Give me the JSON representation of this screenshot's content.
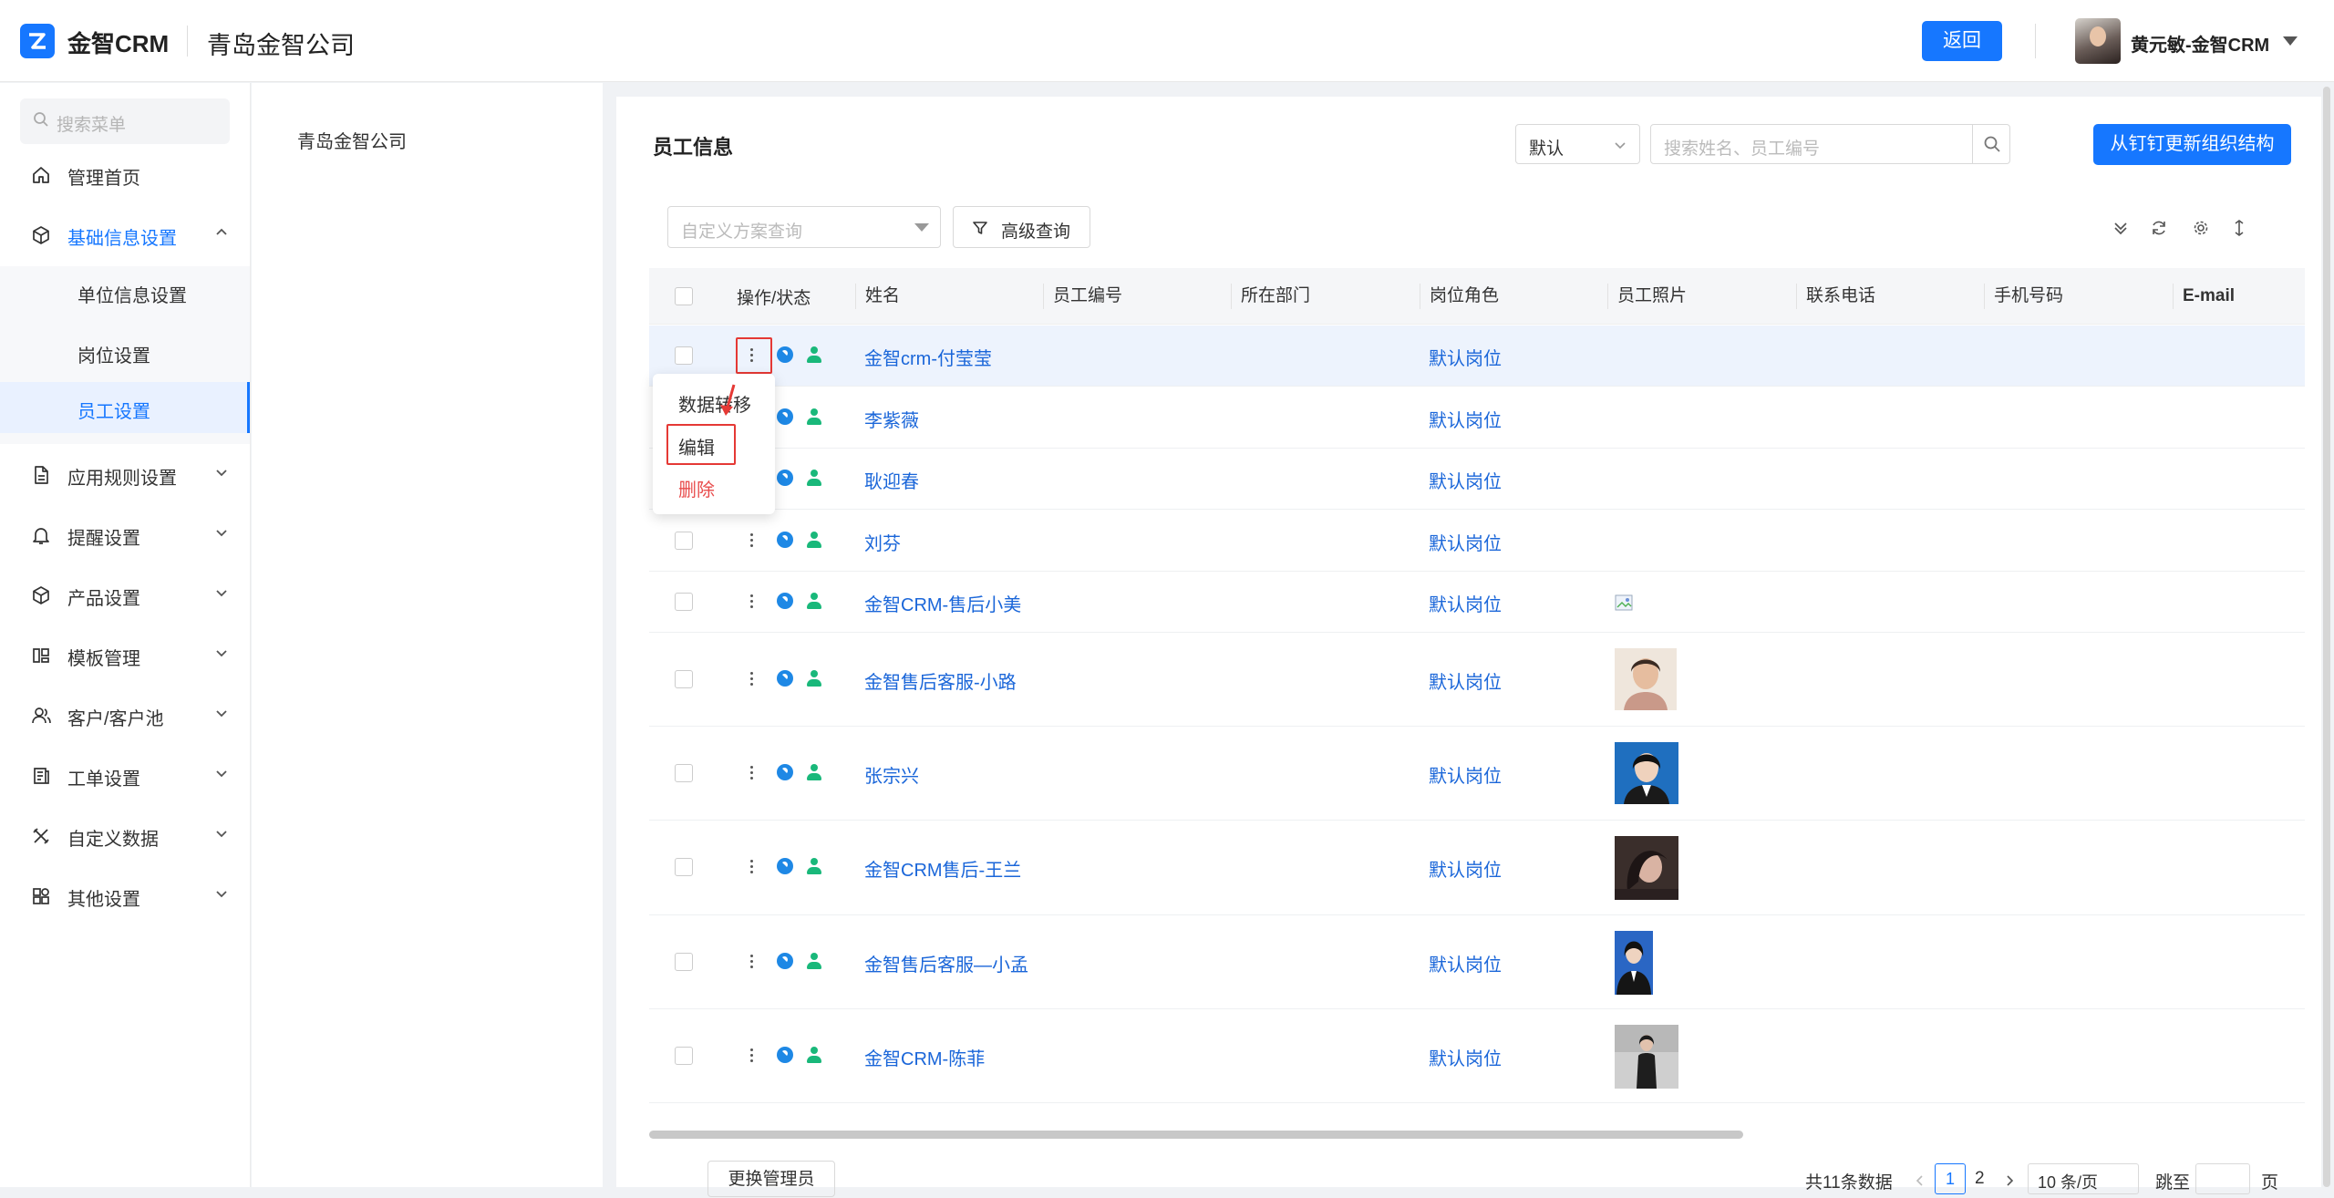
{
  "header": {
    "app_name": "金智CRM",
    "company": "青岛金智公司",
    "back_label": "返回",
    "user_name": "黄元敏-金智CRM"
  },
  "sidebar": {
    "search_placeholder": "搜索菜单",
    "items": [
      {
        "label": "管理首页",
        "icon": "home-icon"
      },
      {
        "label": "基础信息设置",
        "icon": "cube-icon",
        "expanded": true
      },
      {
        "label": "应用规则设置",
        "icon": "document-icon"
      },
      {
        "label": "提醒设置",
        "icon": "bell-icon"
      },
      {
        "label": "产品设置",
        "icon": "box-icon"
      },
      {
        "label": "模板管理",
        "icon": "template-icon"
      },
      {
        "label": "客户/客户池",
        "icon": "users-icon"
      },
      {
        "label": "工单设置",
        "icon": "ticket-icon"
      },
      {
        "label": "自定义数据",
        "icon": "tools-icon"
      },
      {
        "label": "其他设置",
        "icon": "grid-icon"
      }
    ],
    "sub_items": [
      {
        "label": "单位信息设置"
      },
      {
        "label": "岗位设置"
      },
      {
        "label": "员工设置",
        "selected": true
      }
    ]
  },
  "org_tree": {
    "root": "青岛金智公司"
  },
  "main": {
    "title": "员工信息",
    "filter_default": "默认",
    "search_placeholder": "搜索姓名、员工编号",
    "sync_button": "从钉钉更新组织结构",
    "plan_placeholder": "自定义方案查询",
    "advanced_query": "高级查询"
  },
  "table": {
    "columns": [
      "操作/状态",
      "姓名",
      "员工编号",
      "所在部门",
      "岗位角色",
      "员工照片",
      "联系电话",
      "手机号码",
      "E-mail"
    ],
    "rows": [
      {
        "name": "金智crm-付莹莹",
        "role": "默认岗位",
        "photo": "none"
      },
      {
        "name": "李紫薇",
        "role": "默认岗位",
        "photo": "none"
      },
      {
        "name": "耿迎春",
        "role": "默认岗位",
        "photo": "none"
      },
      {
        "name": "刘芬",
        "role": "默认岗位",
        "photo": "none"
      },
      {
        "name": "金智CRM-售后小美",
        "role": "默认岗位",
        "photo": "broken"
      },
      {
        "name": "金智售后客服-小路",
        "role": "默认岗位",
        "photo": "portrait"
      },
      {
        "name": "张宗兴",
        "role": "默认岗位",
        "photo": "portrait"
      },
      {
        "name": "金智CRM售后-王兰",
        "role": "默认岗位",
        "photo": "portrait"
      },
      {
        "name": "金智售后客服—小孟",
        "role": "默认岗位",
        "photo": "portrait"
      },
      {
        "name": "金智CRM-陈菲",
        "role": "默认岗位",
        "photo": "portrait"
      }
    ]
  },
  "row_menu": {
    "items": [
      "数据转移",
      "编辑",
      "删除"
    ]
  },
  "footer": {
    "change_admin": "更换管理员",
    "total": "共11条数据",
    "page_current": "1",
    "page_next": "2",
    "page_size": "10 条/页",
    "goto": "跳至",
    "page_unit": "页"
  },
  "colors": {
    "accent": "#1677ff",
    "link": "#1a66d9",
    "danger": "#e84c4c",
    "status_green": "#19b87a"
  }
}
